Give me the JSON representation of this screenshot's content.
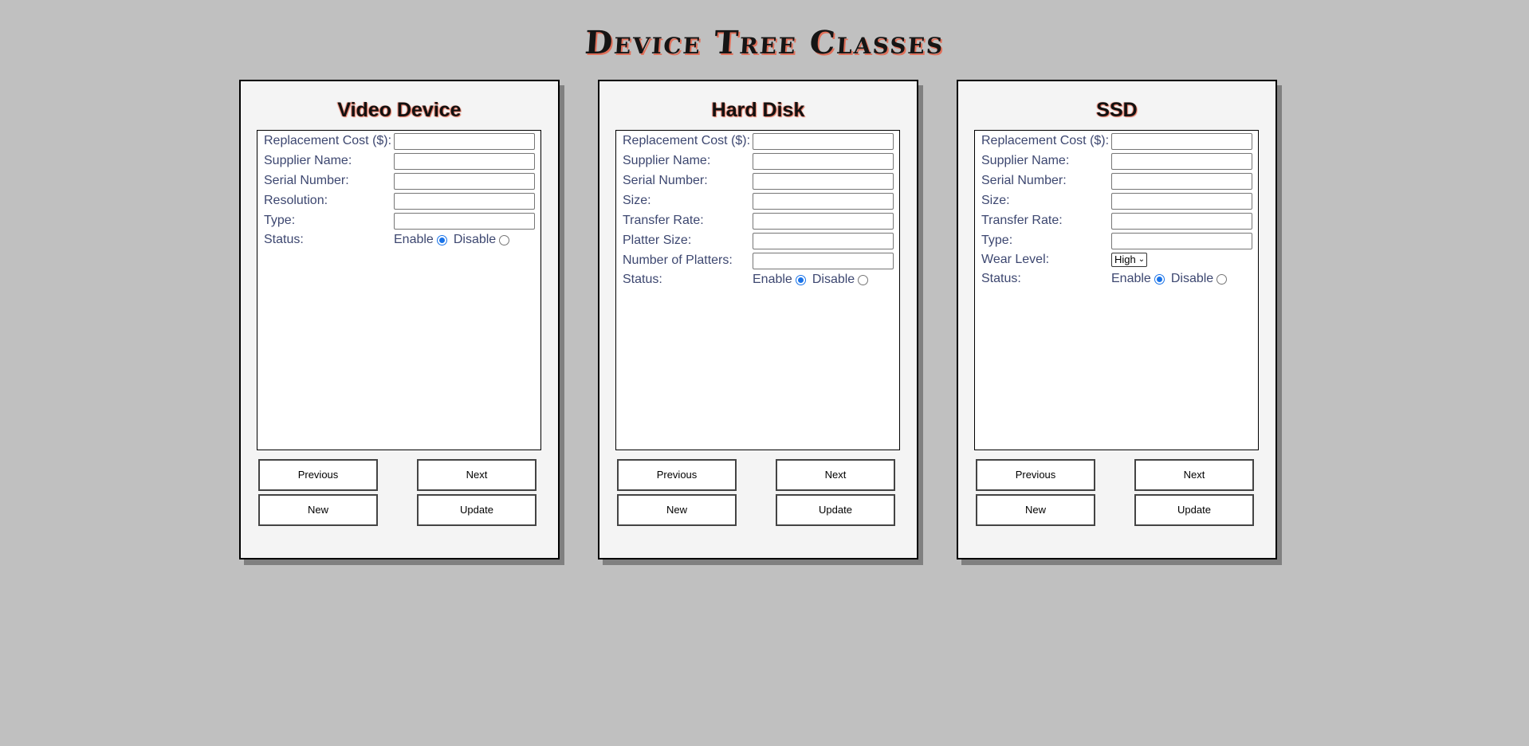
{
  "page": {
    "title": "Device Tree Classes"
  },
  "panels": [
    {
      "title": "Video Device",
      "fields": [
        {
          "label": "Replacement Cost ($):",
          "value": ""
        },
        {
          "label": "Supplier Name:",
          "value": ""
        },
        {
          "label": "Serial Number:",
          "value": ""
        },
        {
          "label": "Resolution:",
          "value": ""
        },
        {
          "label": "Type:",
          "value": ""
        }
      ],
      "status": {
        "label": "Status:",
        "enable": "Enable",
        "disable": "Disable",
        "selected": "Enable"
      },
      "buttons": {
        "previous": "Previous",
        "next": "Next",
        "new": "New",
        "update": "Update"
      }
    },
    {
      "title": "Hard Disk",
      "fields": [
        {
          "label": "Replacement Cost ($):",
          "value": ""
        },
        {
          "label": "Supplier Name:",
          "value": ""
        },
        {
          "label": "Serial Number:",
          "value": ""
        },
        {
          "label": "Size:",
          "value": ""
        },
        {
          "label": "Transfer Rate:",
          "value": ""
        },
        {
          "label": "Platter Size:",
          "value": ""
        },
        {
          "label": "Number of Platters:",
          "value": ""
        }
      ],
      "status": {
        "label": "Status:",
        "enable": "Enable",
        "disable": "Disable",
        "selected": "Enable"
      },
      "buttons": {
        "previous": "Previous",
        "next": "Next",
        "new": "New",
        "update": "Update"
      }
    },
    {
      "title": "SSD",
      "fields": [
        {
          "label": "Replacement Cost ($):",
          "value": ""
        },
        {
          "label": "Supplier Name:",
          "value": ""
        },
        {
          "label": "Serial Number:",
          "value": ""
        },
        {
          "label": "Size:",
          "value": ""
        },
        {
          "label": "Transfer Rate:",
          "value": ""
        },
        {
          "label": "Type:",
          "value": ""
        }
      ],
      "wear_level": {
        "label": "Wear Level:",
        "selected": "High"
      },
      "status": {
        "label": "Status:",
        "enable": "Enable",
        "disable": "Disable",
        "selected": "Enable"
      },
      "buttons": {
        "previous": "Previous",
        "next": "Next",
        "new": "New",
        "update": "Update"
      }
    }
  ],
  "colors": {
    "background": "#c0c0c0",
    "panel": "#f4f4f4",
    "label_text": "#3d4770",
    "title_shadow": "#e0705a",
    "radio_accent": "#1a73e8"
  }
}
